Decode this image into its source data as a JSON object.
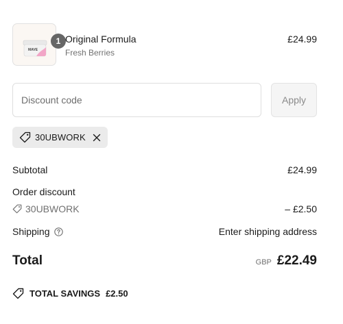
{
  "product": {
    "name": "Original Formula",
    "variant": "Fresh Berries",
    "price": "£24.99",
    "quantity": "1",
    "image_icon": "product-jar-icon"
  },
  "discount": {
    "placeholder": "Discount code",
    "apply_label": "Apply",
    "applied_code": "30UBWORK"
  },
  "summary": {
    "subtotal_label": "Subtotal",
    "subtotal_value": "£24.99",
    "order_discount_label": "Order discount",
    "discount_code": "30UBWORK",
    "discount_value": "– £2.50",
    "shipping_label": "Shipping",
    "shipping_value": "Enter shipping address",
    "total_label": "Total",
    "currency": "GBP",
    "total_value": "£22.49"
  },
  "savings": {
    "label": "TOTAL SAVINGS",
    "value": "£2.50"
  },
  "colors": {
    "text": "#1a1a1a",
    "muted": "#707070",
    "chip_bg": "#ebebeb",
    "badge_bg": "#666666"
  }
}
